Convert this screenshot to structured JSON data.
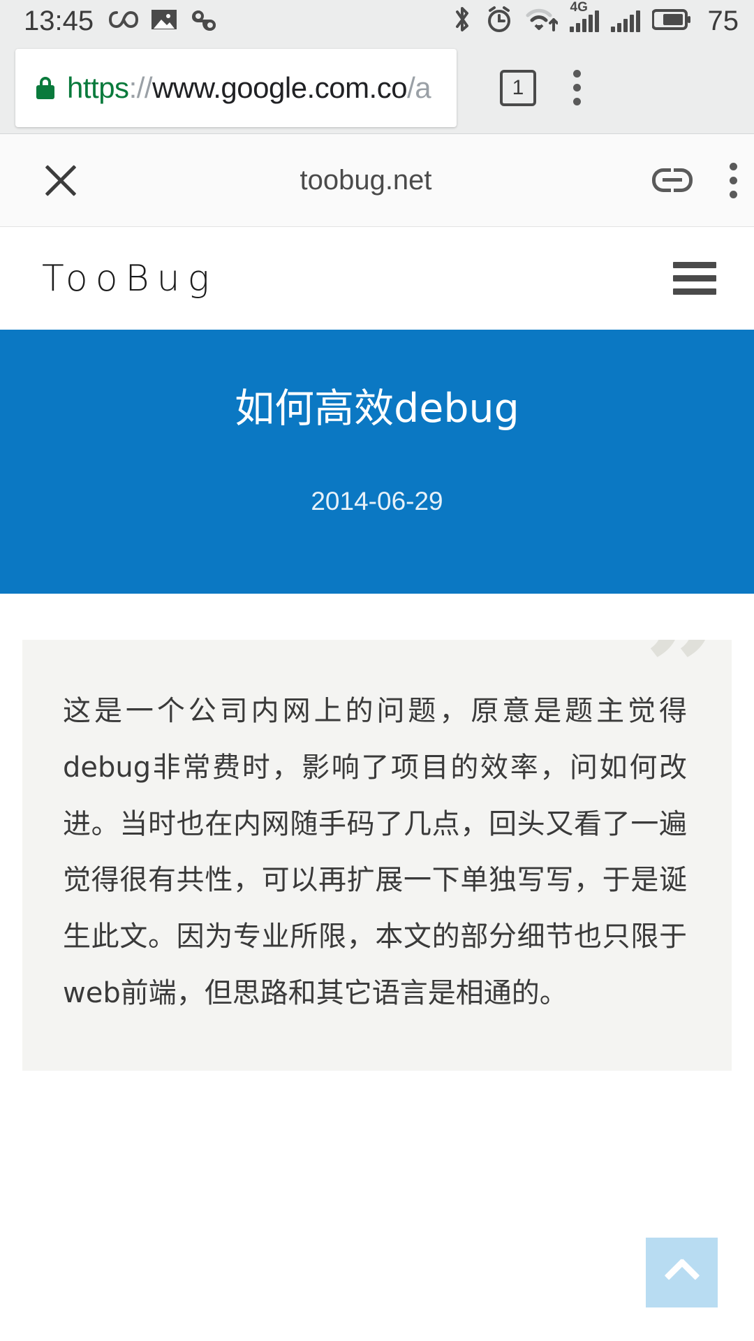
{
  "status_bar": {
    "time": "13:45",
    "battery_percent": "75",
    "network_label": "4G",
    "left_icons": [
      "infinity-icon",
      "image-icon",
      "bug-icon"
    ],
    "right_icons": [
      "bluetooth-icon",
      "alarm-icon",
      "wifi-icon",
      "signal-icon-4g",
      "signal-icon-2",
      "battery-icon"
    ]
  },
  "browser": {
    "url_scheme": "https",
    "url_separator": "://",
    "url_host": "www.google.com.co",
    "url_path": "/a",
    "lock_icon": "lock-icon",
    "tab_count": "1",
    "menu_icon": "kebab-menu-icon"
  },
  "amp_bar": {
    "close_icon": "close-icon",
    "origin": "toobug.net",
    "link_icon": "link-icon",
    "menu_icon": "kebab-menu-icon"
  },
  "site_header": {
    "logo": "TooBug",
    "menu_icon": "hamburger-icon"
  },
  "hero": {
    "title": "如何高效debug",
    "date": "2014-06-29",
    "background_color": "#0b78c3"
  },
  "article": {
    "quote_mark": "”",
    "quote_text": "这是一个公司内网上的问题，原意是题主觉得debug非常费时，影响了项目的效率，问如何改进。当时也在内网随手码了几点，回头又看了一遍觉得很有共性，可以再扩展一下单独写写，于是诞生此文。因为专业所限，本文的部分细节也只限于web前端，但思路和其它语言是相通的。",
    "card_background": "#f4f4f2"
  },
  "scroll_top": {
    "icon": "chevron-up-icon",
    "background_color": "#b8dcf2"
  }
}
